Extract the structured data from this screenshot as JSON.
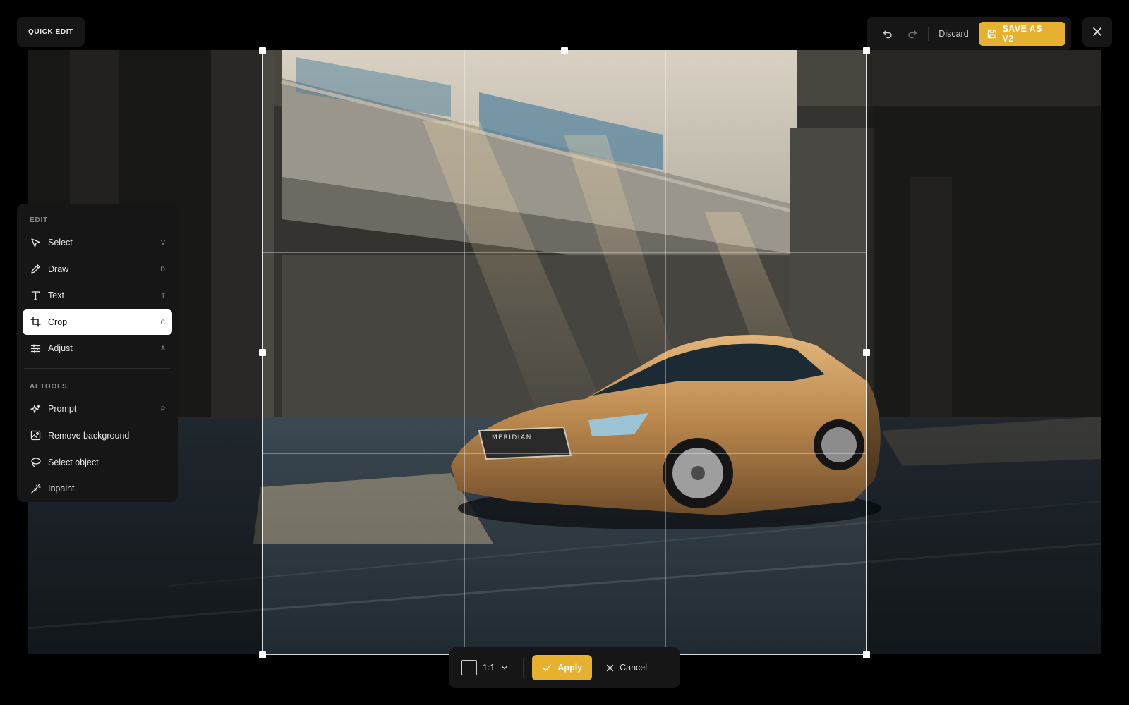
{
  "badge": {
    "label": "QUICK EDIT"
  },
  "toolbar": {
    "undo_icon": "undo-icon",
    "redo_icon": "redo-icon",
    "discard_label": "Discard",
    "save_label": "SAVE AS V2",
    "close_icon": "close-icon"
  },
  "panel": {
    "edit_section": "EDIT",
    "edit_tools": [
      {
        "label": "Select",
        "key": "V",
        "icon": "cursor-icon"
      },
      {
        "label": "Draw",
        "key": "D",
        "icon": "pencil-icon"
      },
      {
        "label": "Text",
        "key": "T",
        "icon": "text-icon"
      },
      {
        "label": "Crop",
        "key": "C",
        "icon": "crop-icon",
        "active": true
      },
      {
        "label": "Adjust",
        "key": "A",
        "icon": "sliders-icon"
      }
    ],
    "ai_section": "AI TOOLS",
    "ai_tools": [
      {
        "label": "Prompt",
        "key": "P",
        "icon": "sparkle-icon"
      },
      {
        "label": "Remove background",
        "key": "",
        "icon": "image-remove-icon"
      },
      {
        "label": "Select object",
        "key": "",
        "icon": "lasso-icon"
      },
      {
        "label": "Inpaint",
        "key": "",
        "icon": "magic-wand-icon"
      }
    ]
  },
  "photo": {
    "car_badge": "MERIDIAN"
  },
  "cropbar": {
    "ratio_label": "1:1",
    "apply_label": "Apply",
    "cancel_label": "Cancel"
  },
  "colors": {
    "accent": "#e6b12e",
    "panel": "#161616",
    "background": "#000000"
  }
}
